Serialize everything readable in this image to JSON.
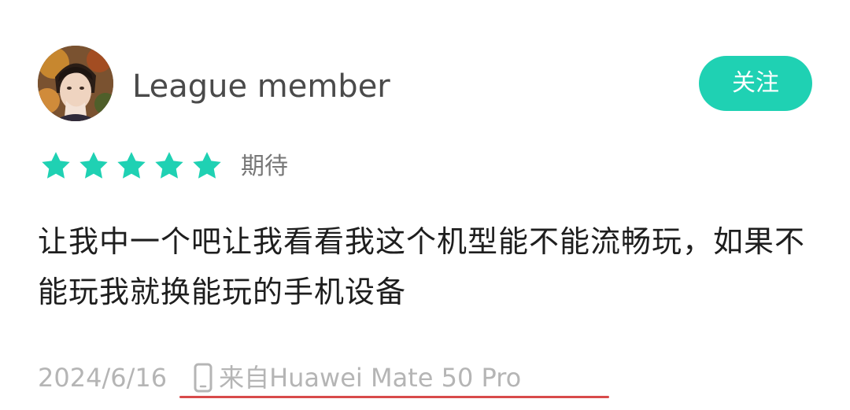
{
  "user": {
    "name": "League member",
    "avatar_icon": "avatar-image"
  },
  "follow": {
    "label": "关注",
    "color": "#1fd1b3"
  },
  "rating": {
    "stars": 5,
    "max": 5,
    "label": "期待",
    "star_color": "#1fd1b3"
  },
  "review": {
    "text": "让我中一个吧让我看看我这个机型能不能流畅玩，如果不能玩我就换能玩的手机设备"
  },
  "meta": {
    "date": "2024/6/16",
    "device_icon": "phone-icon",
    "device": "来自Huawei Mate 50 Pro",
    "underline_color": "#d84a4a"
  }
}
